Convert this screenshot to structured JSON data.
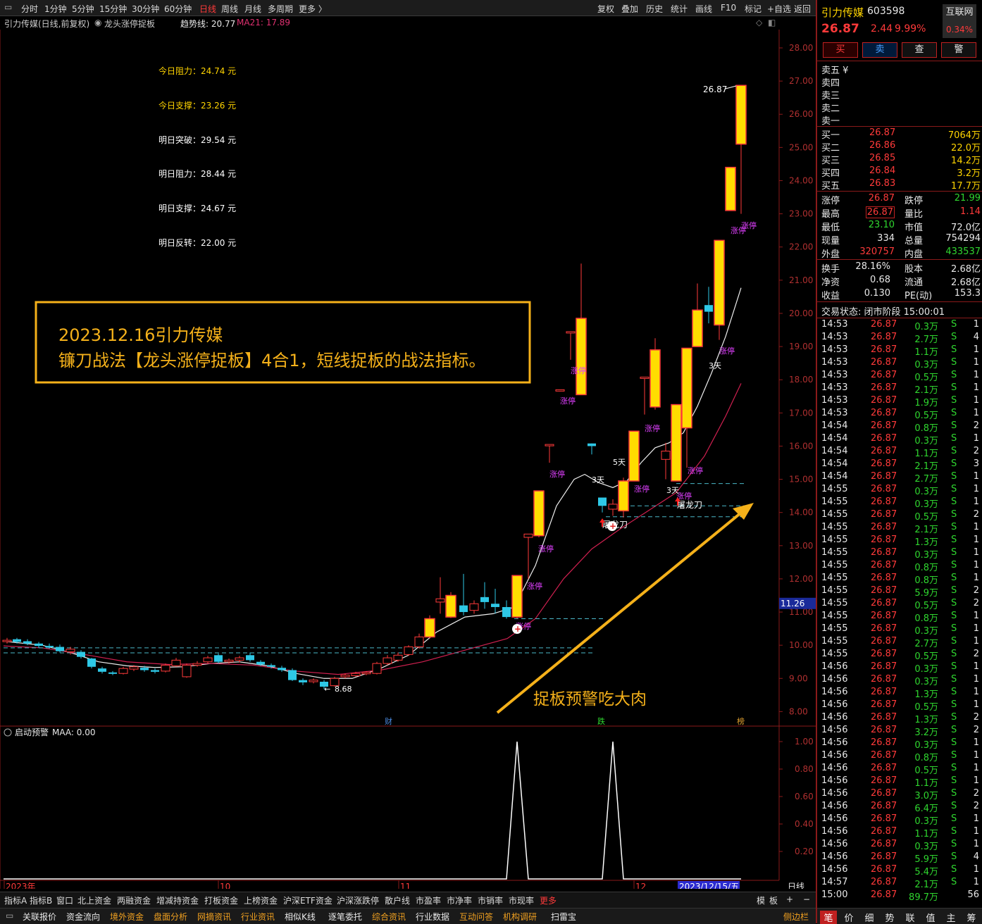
{
  "topbar": {
    "periods": [
      "分时",
      "1分钟",
      "5分钟",
      "15分钟",
      "30分钟",
      "60分钟",
      "日线",
      "周线",
      "月线",
      "多周期",
      "更多 〉"
    ],
    "active_period": "日线",
    "tools": [
      "复权",
      "叠加",
      "历史",
      "统计",
      "画线",
      "F10",
      "标记",
      "+自选",
      "返回"
    ]
  },
  "subbar": {
    "title": "引力传媒(日线,前复权)",
    "indicator": "龙头涨停捉板",
    "trend_label": "趋势线: 20.77",
    "ma21_label": "MA21: 17.89"
  },
  "levels": [
    {
      "label": "今日阻力：24.74 元",
      "color": "#ffd400"
    },
    {
      "label": "今日支撑：23.26 元",
      "color": "#ffd400"
    },
    {
      "label": "明日突破：29.54 元",
      "color": "#ffffff"
    },
    {
      "label": "明日阻力：28.44 元",
      "color": "#ffffff"
    },
    {
      "label": "明日支撑：24.67 元",
      "color": "#ffffff"
    },
    {
      "label": "明日反转：22.00 元",
      "color": "#ffffff"
    }
  ],
  "banner": {
    "line1": "2023.12.16引力传媒",
    "line2": "镰刀战法【龙头涨停捉板】4合1，短线捉板的战法指标。"
  },
  "arrow_text": "捉板预警吃大肉",
  "price_axis": [
    "28.00",
    "27.00",
    "26.00",
    "25.00",
    "24.00",
    "23.00",
    "22.00",
    "21.00",
    "20.00",
    "19.00",
    "18.00",
    "17.00",
    "16.00",
    "15.00",
    "14.00",
    "13.00",
    "12.00",
    "11.00",
    "10.00",
    "9.00",
    "8.00"
  ],
  "price_marker": "11.26",
  "high_label": "26.87",
  "low_label": "8.68",
  "candle_marks": {
    "zt": "涨停",
    "d3": "3天",
    "d5": "5天",
    "tlr": "屠龙刀"
  },
  "event_marks": [
    "财",
    "跌",
    "榜"
  ],
  "sub_indicator": {
    "title": "启动预警",
    "maa": "MAA: 0.00",
    "axis": [
      "1.00",
      "0.80",
      "0.60",
      "0.40",
      "0.20"
    ]
  },
  "time_axis": {
    "labels": [
      "2023年",
      "10",
      "11",
      "12"
    ],
    "current": "2023/12/15/五",
    "period_btn": "日线"
  },
  "bottom_tabs1": [
    "指标A",
    "指标B",
    "窗口",
    "北上资金",
    "两融资金",
    "增减持资金",
    "打板资金",
    "上榜资金",
    "沪深ETF资金",
    "沪深涨跌停",
    "散户线",
    "市盈率",
    "市净率",
    "市销率",
    "市现率",
    "更多"
  ],
  "bottom_right1": [
    "模",
    "板",
    "+",
    "−"
  ],
  "bottom_tabs2": [
    "关联报价",
    "资金流向",
    "境外资金",
    "盘面分析",
    "网摘资讯",
    "行业资讯",
    "相似K线",
    "逐笔委托",
    "综合资讯",
    "行业数据",
    "互动问答",
    "机构调研",
    "扫雷宝"
  ],
  "bottom_right2": "侧边栏",
  "stock": {
    "name": "引力传媒",
    "code": "603598",
    "price": "26.87",
    "change": "2.44",
    "pct": "9.99%",
    "badge": "互联网",
    "badge_pct": "0.34%"
  },
  "trade_buttons": [
    "买",
    "卖",
    "查",
    "警"
  ],
  "asks": [
    {
      "label": "卖五 ¥"
    },
    {
      "label": "卖四"
    },
    {
      "label": "卖三"
    },
    {
      "label": "卖二"
    },
    {
      "label": "卖一"
    }
  ],
  "bids": [
    {
      "label": "买一",
      "price": "26.87",
      "vol": "7064万"
    },
    {
      "label": "买二",
      "price": "26.86",
      "vol": "22.0万"
    },
    {
      "label": "买三",
      "price": "26.85",
      "vol": "14.2万"
    },
    {
      "label": "买四",
      "price": "26.84",
      "vol": "3.2万"
    },
    {
      "label": "买五",
      "price": "26.83",
      "vol": "17.7万"
    }
  ],
  "stats1": [
    {
      "l1": "涨停",
      "v1": "26.87",
      "c1": "red",
      "l2": "跌停",
      "v2": "21.99",
      "c2": "grn"
    },
    {
      "l1": "最高",
      "v1": "26.87",
      "c1": "red",
      "l2": "量比",
      "v2": "1.14",
      "c2": "red"
    },
    {
      "l1": "最低",
      "v1": "23.10",
      "c1": "grn",
      "l2": "市值",
      "v2": "72.0亿",
      "c2": "wht"
    },
    {
      "l1": "现量",
      "v1": "334",
      "c1": "wht",
      "l2": "总量",
      "v2": "754294",
      "c2": "wht"
    },
    {
      "l1": "外盘",
      "v1": "320757",
      "c1": "red",
      "l2": "内盘",
      "v2": "433537",
      "c2": "grn"
    }
  ],
  "stats2": [
    {
      "l1": "换手",
      "v1": "28.16%",
      "l2": "股本",
      "v2": "2.68亿"
    },
    {
      "l1": "净资",
      "v1": "0.68",
      "l2": "流通",
      "v2": "2.68亿"
    },
    {
      "l1": "收益",
      "v1": "0.130",
      "l2": "PE(动)",
      "v2": "153.3"
    }
  ],
  "trade_status": "交易状态: 闭市阶段 15:00:01",
  "ticks": [
    [
      "14:53",
      "26.87",
      "0.3万",
      "S",
      "1"
    ],
    [
      "14:53",
      "26.87",
      "2.7万",
      "S",
      "4"
    ],
    [
      "14:53",
      "26.87",
      "1.1万",
      "S",
      "1"
    ],
    [
      "14:53",
      "26.87",
      "0.3万",
      "S",
      "1"
    ],
    [
      "14:53",
      "26.87",
      "0.5万",
      "S",
      "1"
    ],
    [
      "14:53",
      "26.87",
      "2.1万",
      "S",
      "1"
    ],
    [
      "14:53",
      "26.87",
      "1.9万",
      "S",
      "1"
    ],
    [
      "14:53",
      "26.87",
      "0.5万",
      "S",
      "1"
    ],
    [
      "14:54",
      "26.87",
      "0.8万",
      "S",
      "2"
    ],
    [
      "14:54",
      "26.87",
      "0.3万",
      "S",
      "1"
    ],
    [
      "14:54",
      "26.87",
      "1.1万",
      "S",
      "2"
    ],
    [
      "14:54",
      "26.87",
      "2.1万",
      "S",
      "3"
    ],
    [
      "14:54",
      "26.87",
      "2.7万",
      "S",
      "1"
    ],
    [
      "14:55",
      "26.87",
      "0.3万",
      "S",
      "1"
    ],
    [
      "14:55",
      "26.87",
      "0.3万",
      "S",
      "1"
    ],
    [
      "14:55",
      "26.87",
      "0.5万",
      "S",
      "2"
    ],
    [
      "14:55",
      "26.87",
      "2.1万",
      "S",
      "1"
    ],
    [
      "14:55",
      "26.87",
      "1.3万",
      "S",
      "1"
    ],
    [
      "14:55",
      "26.87",
      "0.3万",
      "S",
      "1"
    ],
    [
      "14:55",
      "26.87",
      "0.8万",
      "S",
      "1"
    ],
    [
      "14:55",
      "26.87",
      "0.8万",
      "S",
      "1"
    ],
    [
      "14:55",
      "26.87",
      "5.9万",
      "S",
      "2"
    ],
    [
      "14:55",
      "26.87",
      "0.5万",
      "S",
      "2"
    ],
    [
      "14:55",
      "26.87",
      "0.8万",
      "S",
      "1"
    ],
    [
      "14:55",
      "26.87",
      "0.3万",
      "S",
      "1"
    ],
    [
      "14:55",
      "26.87",
      "2.7万",
      "S",
      "1"
    ],
    [
      "14:55",
      "26.87",
      "0.5万",
      "S",
      "2"
    ],
    [
      "14:56",
      "26.87",
      "0.3万",
      "S",
      "1"
    ],
    [
      "14:56",
      "26.87",
      "0.3万",
      "S",
      "1"
    ],
    [
      "14:56",
      "26.87",
      "1.3万",
      "S",
      "1"
    ],
    [
      "14:56",
      "26.87",
      "0.5万",
      "S",
      "1"
    ],
    [
      "14:56",
      "26.87",
      "1.3万",
      "S",
      "2"
    ],
    [
      "14:56",
      "26.87",
      "3.2万",
      "S",
      "2"
    ],
    [
      "14:56",
      "26.87",
      "0.3万",
      "S",
      "1"
    ],
    [
      "14:56",
      "26.87",
      "0.8万",
      "S",
      "1"
    ],
    [
      "14:56",
      "26.87",
      "0.5万",
      "S",
      "1"
    ],
    [
      "14:56",
      "26.87",
      "1.1万",
      "S",
      "1"
    ],
    [
      "14:56",
      "26.87",
      "3.0万",
      "S",
      "2"
    ],
    [
      "14:56",
      "26.87",
      "6.4万",
      "S",
      "2"
    ],
    [
      "14:56",
      "26.87",
      "0.3万",
      "S",
      "1"
    ],
    [
      "14:56",
      "26.87",
      "1.1万",
      "S",
      "1"
    ],
    [
      "14:56",
      "26.87",
      "0.3万",
      "S",
      "1"
    ],
    [
      "14:56",
      "26.87",
      "5.9万",
      "S",
      "4"
    ],
    [
      "14:56",
      "26.87",
      "5.4万",
      "S",
      "1"
    ],
    [
      "14:57",
      "26.87",
      "2.1万",
      "S",
      "1"
    ],
    [
      "15:00",
      "26.87",
      "89.7万",
      "",
      "56"
    ]
  ],
  "right_bottom_tabs": [
    "笔",
    "价",
    "细",
    "势",
    "联",
    "值",
    "主",
    "筹"
  ]
}
